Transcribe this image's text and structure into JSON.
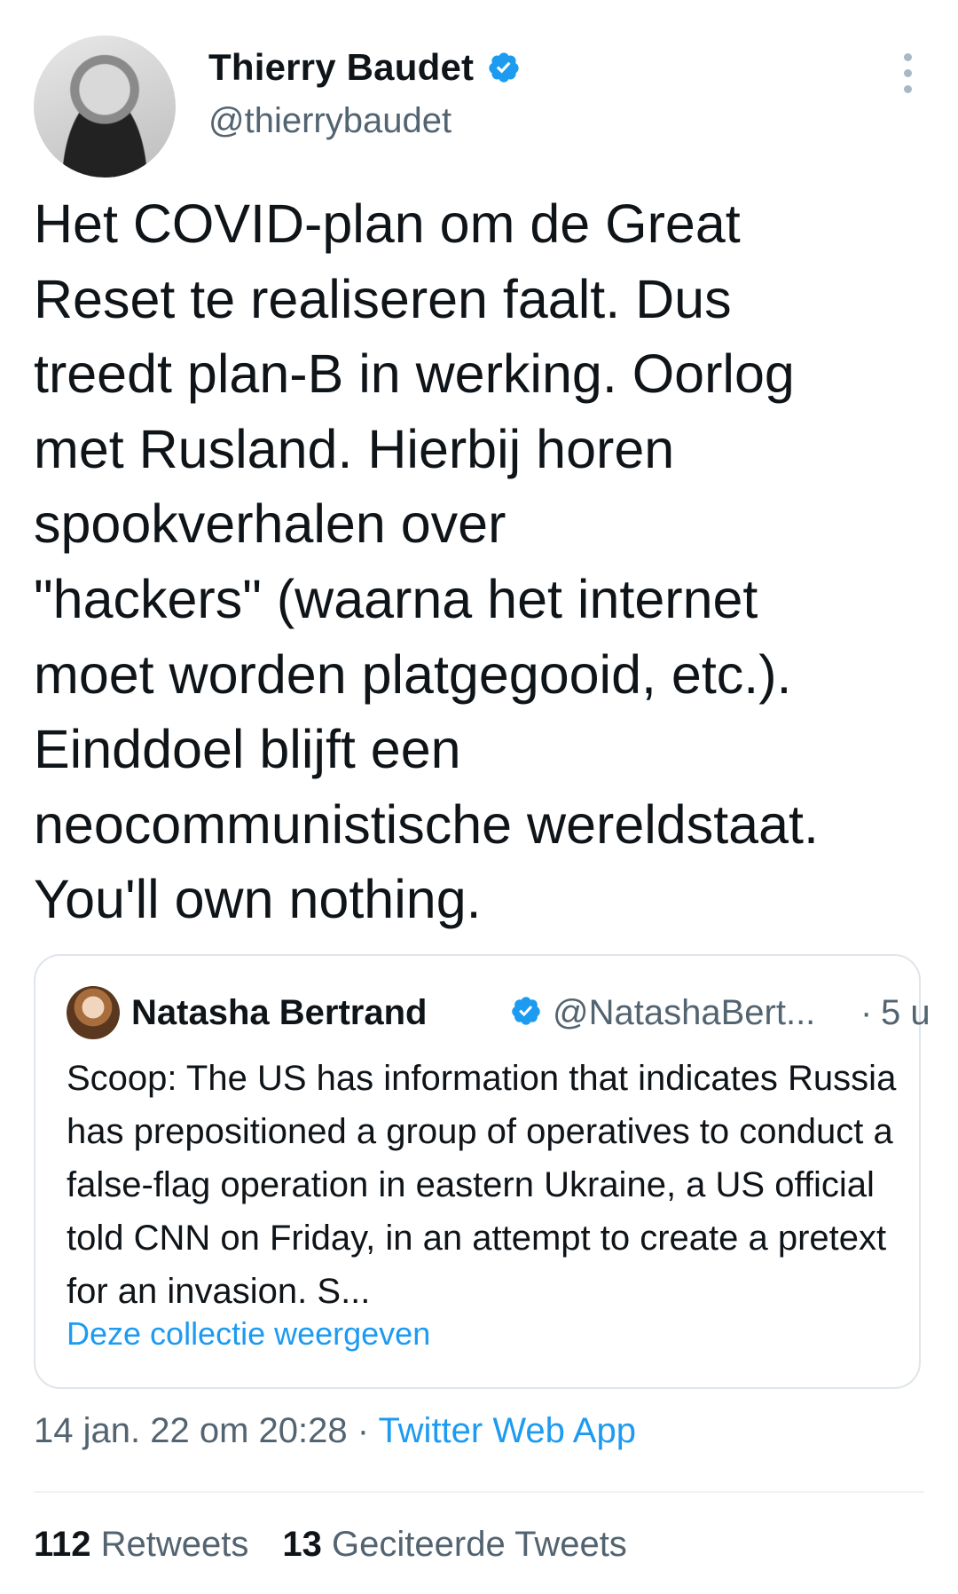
{
  "author": {
    "display_name": "Thierry Baudet",
    "handle": "@thierrybaudet",
    "verified": true,
    "avatar_icon": "profile-photo"
  },
  "tweet": {
    "text": "Het COVID-plan om de Great\nReset te realiseren faalt. Dus\ntreedt plan-B in werking. Oorlog\nmet Rusland. Hierbij horen\nspookverhalen over\n\"hackers\" (waarna het internet\nmoet worden platgegooid, etc.).\nEinddoel blijft een\nneocommunistische wereldstaat.\nYou'll own nothing."
  },
  "quoted_tweet": {
    "display_name": "Natasha Bertrand",
    "handle": "@NatashaBert...",
    "separator": "·",
    "time": "5 u",
    "text": "Scoop: The US has information that indicates Russia has prepositioned a group of operatives to conduct a false-flag operation in eastern Ukraine, a US official told CNN on Friday, in an attempt to create a pretext for an invasion. S...",
    "link_label": "Deze collectie weergeven"
  },
  "meta": {
    "timestamp": "14 jan. 22 om 20:28",
    "separator": "·",
    "source": "Twitter Web App"
  },
  "stats": {
    "retweets_count": "112",
    "retweets_label": "Retweets",
    "quotes_count": "13",
    "quotes_label": "Geciteerde Tweets"
  },
  "colors": {
    "accent": "#1d9bf0",
    "secondary_text": "#536471",
    "primary_text": "#0f1419"
  }
}
